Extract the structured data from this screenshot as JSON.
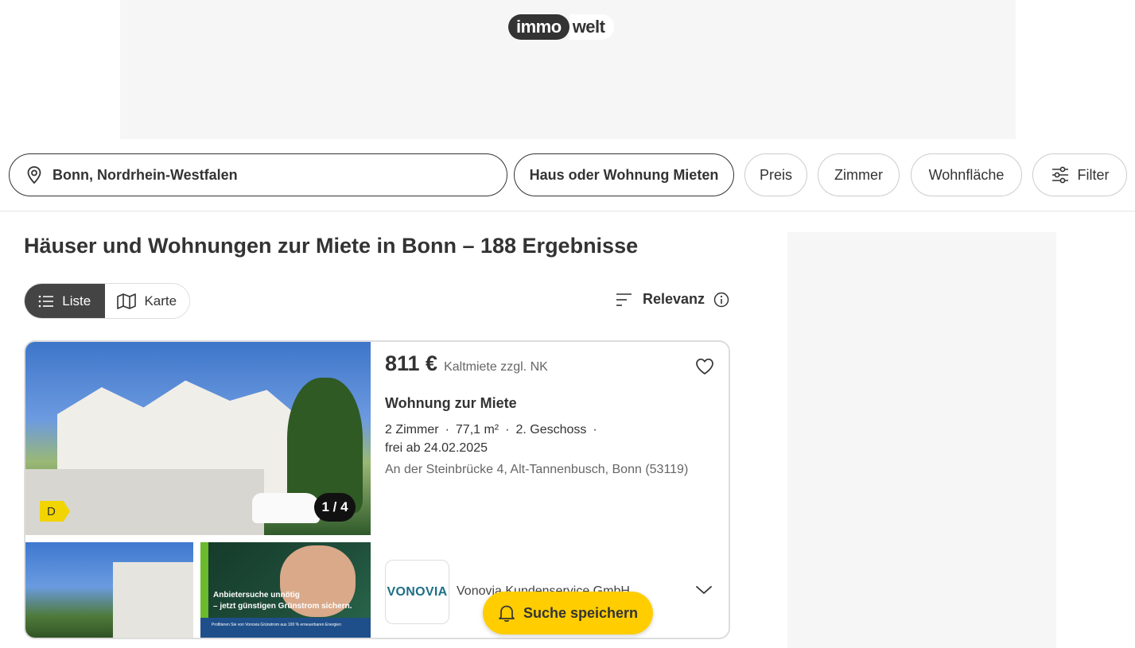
{
  "header": {
    "logo_part1": "immo",
    "logo_part2": "welt"
  },
  "filters": {
    "location": "Bonn, Nordrhein-Westfalen",
    "purpose": "Haus oder Wohnung Mieten",
    "price": "Preis",
    "rooms": "Zimmer",
    "area": "Wohnfläche",
    "more": "Filter"
  },
  "results": {
    "heading": "Häuser und Wohnungen zur Miete in Bonn – 188 Ergebnisse",
    "view_list": "Liste",
    "view_map": "Karte",
    "sort_label": "Relevanz"
  },
  "listing": {
    "price": "811 €",
    "price_note": "Kaltmiete zzgl. NK",
    "title": "Wohnung zur Miete",
    "rooms": "2 Zimmer",
    "area": "77,1 m²",
    "floor": "2. Geschoss",
    "available": "frei ab 24.02.2025",
    "address": "An der Steinbrücke 4, Alt-Tannenbusch, Bonn (53119)",
    "energy_class": "D",
    "image_counter": "1 / 4",
    "ad_line1": "Anbietersuche unnötig",
    "ad_line2": "– jetzt günstigen Grünstrom sichern.",
    "ad_small": "Profitieren Sie von Vonovia Grünstrom aus 100 % erneuerbaren Energien",
    "provider_logo": "VONOVIA",
    "provider_name": "Vonovia Kundenservice GmbH"
  },
  "save_search": {
    "label": "Suche speichern"
  },
  "colors": {
    "accent_yellow": "#ffcd00",
    "dark": "#333333",
    "energy_yellow": "#f2d400",
    "vonovia_teal": "#1d6f86"
  },
  "icons": {
    "location": "map-pin-icon",
    "filter": "sliders-icon",
    "list": "list-icon",
    "map": "map-icon",
    "sort": "sort-lines-icon",
    "info": "info-icon",
    "favorite": "heart-icon",
    "expand": "chevron-down-icon",
    "bell": "bell-icon"
  }
}
